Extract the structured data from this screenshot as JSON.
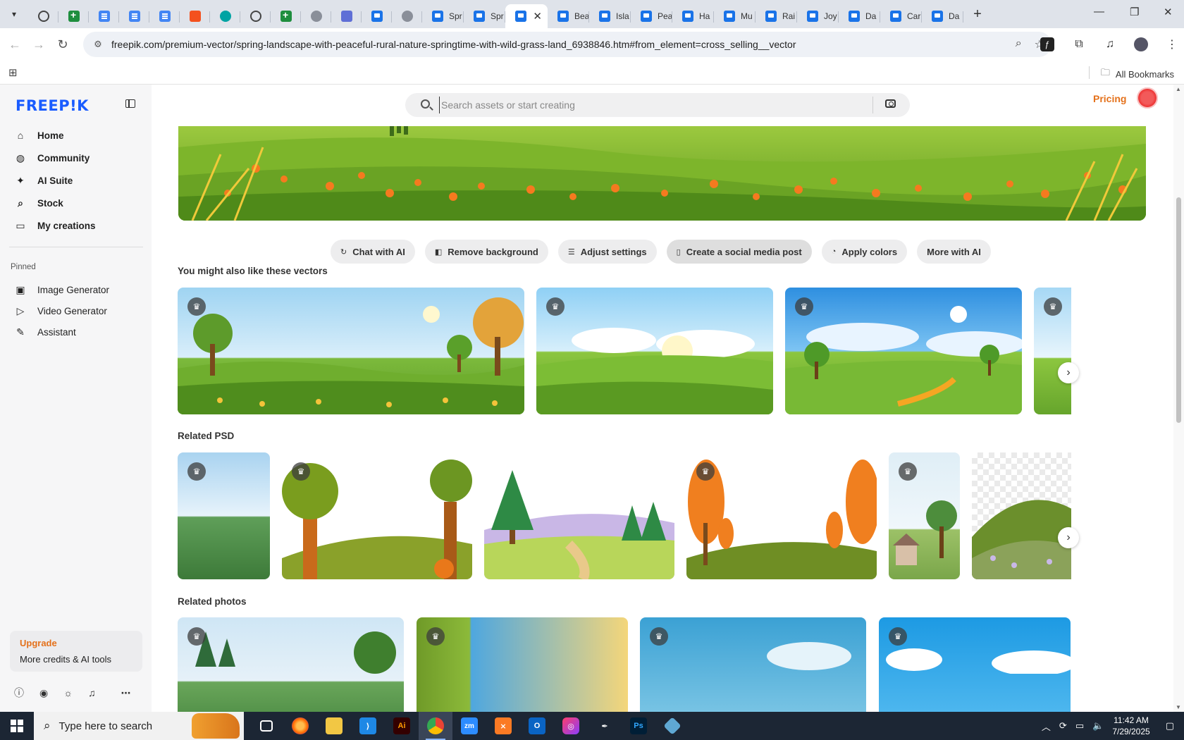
{
  "browser": {
    "tabs": [
      {
        "icon": "wordpress-icon",
        "label": "",
        "fav": "fav-circle"
      },
      {
        "icon": "sheets-icon",
        "label": "",
        "fav": "fav-green"
      },
      {
        "icon": "docs-icon",
        "label": "",
        "fav": "fav-doc"
      },
      {
        "icon": "docs-icon",
        "label": "",
        "fav": "fav-doc"
      },
      {
        "icon": "docs-icon",
        "label": "",
        "fav": "fav-doc"
      },
      {
        "icon": "orange-app-icon",
        "label": "",
        "fav": "fav-orange"
      },
      {
        "icon": "teal-app-icon",
        "label": "",
        "fav": "fav-teal"
      },
      {
        "icon": "openai-icon",
        "label": "",
        "fav": "fav-circle"
      },
      {
        "icon": "sheets-icon",
        "label": "",
        "fav": "fav-green"
      },
      {
        "icon": "globe-icon",
        "label": "",
        "fav": "fav-grey"
      },
      {
        "icon": "extension-icon",
        "label": "",
        "fav": "fav-ext"
      },
      {
        "icon": "freepik-icon",
        "label": "",
        "fav": "fav-blue"
      },
      {
        "icon": "audio-icon",
        "label": "",
        "fav": "fav-grey"
      },
      {
        "icon": "freepik-icon",
        "label": "Spr",
        "fav": "fav-blue"
      },
      {
        "icon": "freepik-icon",
        "label": "Spr",
        "fav": "fav-blue"
      },
      {
        "icon": "freepik-icon",
        "label": "",
        "fav": "fav-blue",
        "active": true
      },
      {
        "icon": "freepik-icon",
        "label": "Bea",
        "fav": "fav-blue"
      },
      {
        "icon": "freepik-icon",
        "label": "Isla",
        "fav": "fav-blue"
      },
      {
        "icon": "freepik-icon",
        "label": "Pea",
        "fav": "fav-blue"
      },
      {
        "icon": "freepik-icon",
        "label": "Ha",
        "fav": "fav-blue"
      },
      {
        "icon": "freepik-icon",
        "label": "Mu",
        "fav": "fav-blue"
      },
      {
        "icon": "freepik-icon",
        "label": "Rai",
        "fav": "fav-blue"
      },
      {
        "icon": "freepik-icon",
        "label": "Joy",
        "fav": "fav-blue"
      },
      {
        "icon": "freepik-icon",
        "label": "Da",
        "fav": "fav-blue"
      },
      {
        "icon": "freepik-icon",
        "label": "Car",
        "fav": "fav-blue"
      },
      {
        "icon": "freepik-icon",
        "label": "Da",
        "fav": "fav-blue"
      }
    ],
    "url": "freepik.com/premium-vector/spring-landscape-with-peaceful-rural-nature-springtime-with-wild-grass-land_6938846.htm#from_element=cross_selling__vector",
    "bookmarks_label": "All Bookmarks"
  },
  "sidebar": {
    "logo": "FREEP!K",
    "nav": [
      {
        "label": "Home",
        "icon": "home-icon",
        "glyph": "⌂"
      },
      {
        "label": "Community",
        "icon": "globe-icon",
        "glyph": "◍"
      },
      {
        "label": "AI Suite",
        "icon": "sparkle-icon",
        "glyph": "✦"
      },
      {
        "label": "Stock",
        "icon": "search-icon",
        "glyph": "⌕"
      },
      {
        "label": "My creations",
        "icon": "folder-icon",
        "glyph": "▭"
      }
    ],
    "pinned_label": "Pinned",
    "pinned": [
      {
        "label": "Image Generator",
        "icon": "image-icon",
        "glyph": "▣"
      },
      {
        "label": "Video Generator",
        "icon": "video-icon",
        "glyph": "▷"
      },
      {
        "label": "Assistant",
        "icon": "chat-icon",
        "glyph": "✎"
      }
    ],
    "upgrade": {
      "title": "Upgrade",
      "subtitle": "More credits & AI tools"
    }
  },
  "header": {
    "search_placeholder": "Search assets or start creating",
    "pricing": "Pricing"
  },
  "ai_actions": [
    {
      "label": "Chat with AI",
      "icon": "chat-icon",
      "glyph": "↻"
    },
    {
      "label": "Remove background",
      "icon": "remove-bg-icon",
      "glyph": "◧"
    },
    {
      "label": "Adjust settings",
      "icon": "sliders-icon",
      "glyph": "☰"
    },
    {
      "label": "Create a social media post",
      "icon": "phone-icon",
      "glyph": "▯"
    },
    {
      "label": "Apply colors",
      "icon": "palette-icon",
      "glyph": "◔"
    },
    {
      "label": "More with AI",
      "icon": "",
      "glyph": ""
    }
  ],
  "sections": {
    "vectors_title": "You might also like these vectors",
    "psd_title": "Related PSD",
    "photos_title": "Related photos"
  },
  "taskbar": {
    "search_placeholder": "Type here to search",
    "time": "11:42 AM",
    "date": "7/29/2025"
  }
}
